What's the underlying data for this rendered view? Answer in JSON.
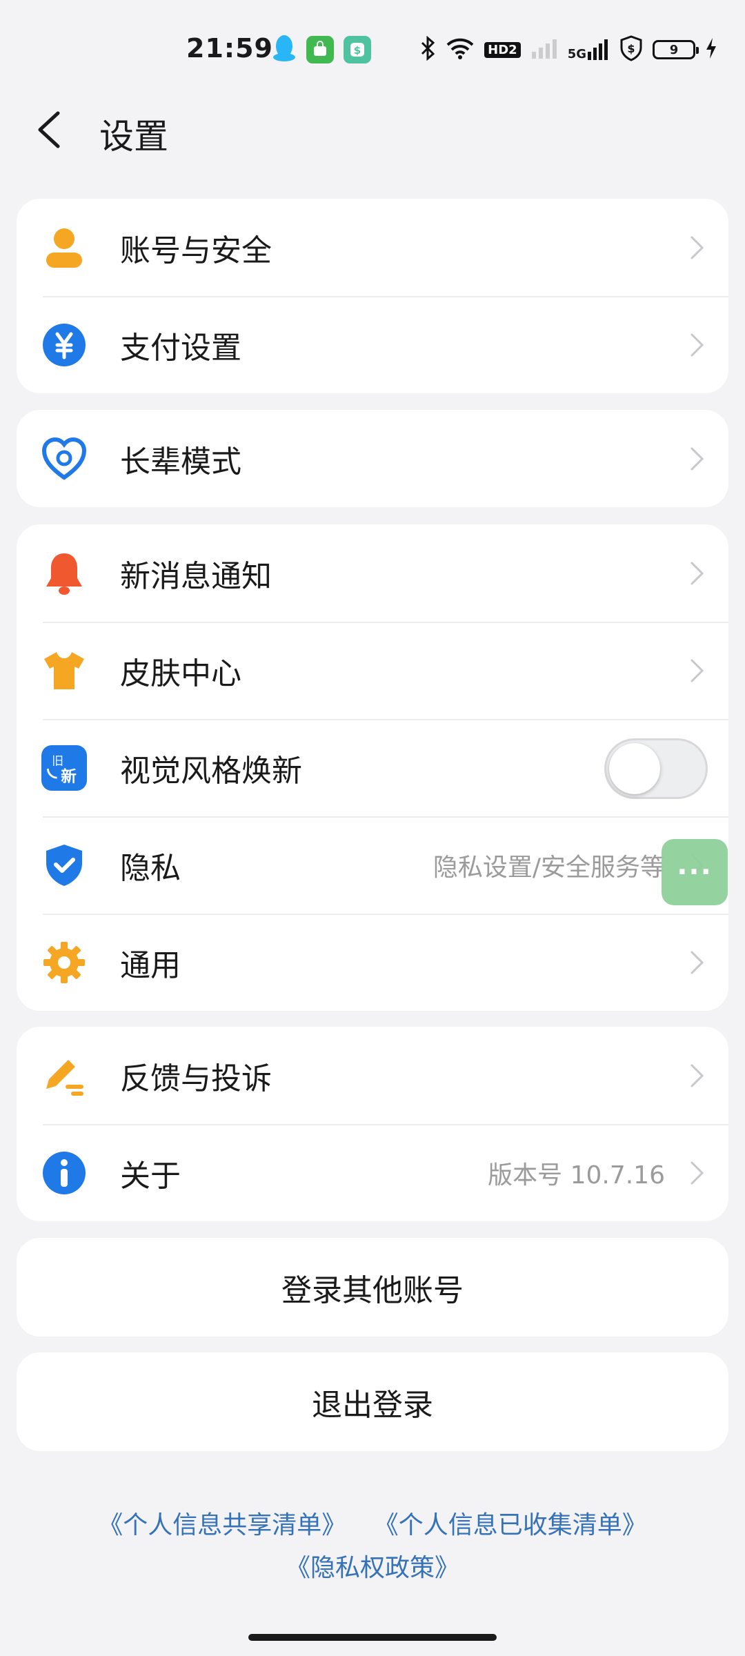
{
  "status": {
    "time": "21:59",
    "hd": "HD2",
    "net": "5G",
    "battery": "9"
  },
  "header": {
    "title": "设置"
  },
  "groups": {
    "g1": [
      {
        "label": "账号与安全",
        "icon": "user-icon"
      },
      {
        "label": "支付设置",
        "icon": "yen-icon"
      }
    ],
    "g2": [
      {
        "label": "长辈模式",
        "icon": "heart-icon"
      }
    ],
    "g3": [
      {
        "label": "新消息通知",
        "icon": "bell-icon"
      },
      {
        "label": "皮肤中心",
        "icon": "tshirt-icon"
      },
      {
        "label": "视觉风格焕新",
        "icon": "refresh-icon",
        "icon_text": "旧新",
        "toggle_on": false
      },
      {
        "label": "隐私",
        "value": "隐私设置/安全服务等",
        "icon": "shield-icon"
      },
      {
        "label": "通用",
        "icon": "gear-icon"
      }
    ],
    "g4": [
      {
        "label": "反馈与投诉",
        "icon": "pen-icon"
      },
      {
        "label": "关于",
        "value": "版本号 10.7.16",
        "icon": "info-icon"
      }
    ]
  },
  "buttons": {
    "login_other": "登录其他账号",
    "logout": "退出登录"
  },
  "floating": {
    "label": "···"
  },
  "links": {
    "shared": "《个人信息共享清单》",
    "collected": "《个人信息已收集清单》",
    "policy": "《隐私权政策》"
  },
  "colors": {
    "orange": "#f5a623",
    "blue": "#1f7ae8",
    "red": "#f0582f",
    "link": "#3572b8"
  }
}
